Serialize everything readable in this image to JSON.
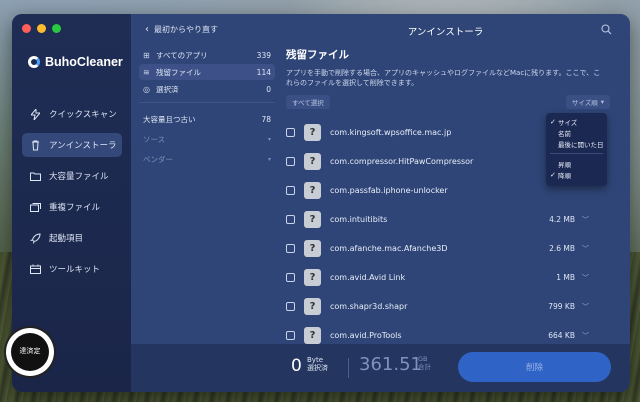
{
  "app": {
    "brand": "BuhoCleaner"
  },
  "sidebar": {
    "items": [
      {
        "label": "クイックスキャン",
        "icon": "lightning-icon"
      },
      {
        "label": "アンインストーラ",
        "icon": "trash-icon"
      },
      {
        "label": "大容量ファイル",
        "icon": "folder-icon"
      },
      {
        "label": "重複ファイル",
        "icon": "duplicate-icon"
      },
      {
        "label": "起動項目",
        "icon": "rocket-icon"
      },
      {
        "label": "ツールキット",
        "icon": "toolkit-icon"
      }
    ]
  },
  "badge": {
    "text": "達済定"
  },
  "header": {
    "back_label": "最初からやり直す",
    "title": "アンインストーラ"
  },
  "categories": [
    {
      "label": "すべてのアプリ",
      "count": "339",
      "icon": "grid-icon"
    },
    {
      "label": "残留ファイル",
      "count": "114",
      "icon": "layers-icon"
    },
    {
      "label": "選択済",
      "count": "0",
      "icon": "check-circle-icon"
    }
  ],
  "categories2": [
    {
      "label": "大容量且つ古い",
      "count": "78"
    },
    {
      "label": "ソース",
      "count": "▾"
    },
    {
      "label": "ベンダー",
      "count": "▾"
    }
  ],
  "content": {
    "title": "残留ファイル",
    "description": "アプリを手動で削除する場合、アプリのキャッシュやログファイルなどMacに残ります。ここで、これらのファイルを選択して削除できます。",
    "select_all": "すべて選択",
    "sort_label": "サイズ順"
  },
  "files": [
    {
      "name": "com.kingsoft.wpsoffice.mac.jp",
      "size": ""
    },
    {
      "name": "com.compressor.HitPawCompressor",
      "size": ""
    },
    {
      "name": "com.passfab.iphone-unlocker",
      "size": ""
    },
    {
      "name": "com.intuitibits",
      "size": "4.2 MB"
    },
    {
      "name": "com.afanche.mac.Afanche3D",
      "size": "2.6 MB"
    },
    {
      "name": "com.avid.Avid Link",
      "size": "1 MB"
    },
    {
      "name": "com.shapr3d.shapr",
      "size": "799 KB"
    },
    {
      "name": "com.avid.ProTools",
      "size": "664 KB"
    }
  ],
  "sort_menu": {
    "items": [
      {
        "label": "サイズ",
        "checked": true
      },
      {
        "label": "名前",
        "checked": false
      },
      {
        "label": "最後に開いた日",
        "checked": false
      }
    ],
    "order": [
      {
        "label": "昇順",
        "checked": false
      },
      {
        "label": "降順",
        "checked": true
      }
    ]
  },
  "footer": {
    "selected_num": "0",
    "selected_unit": "Byte",
    "selected_label": "選択済",
    "total_num": "361.51",
    "total_unit": "GB",
    "total_label": "合計",
    "delete_label": "削除"
  }
}
